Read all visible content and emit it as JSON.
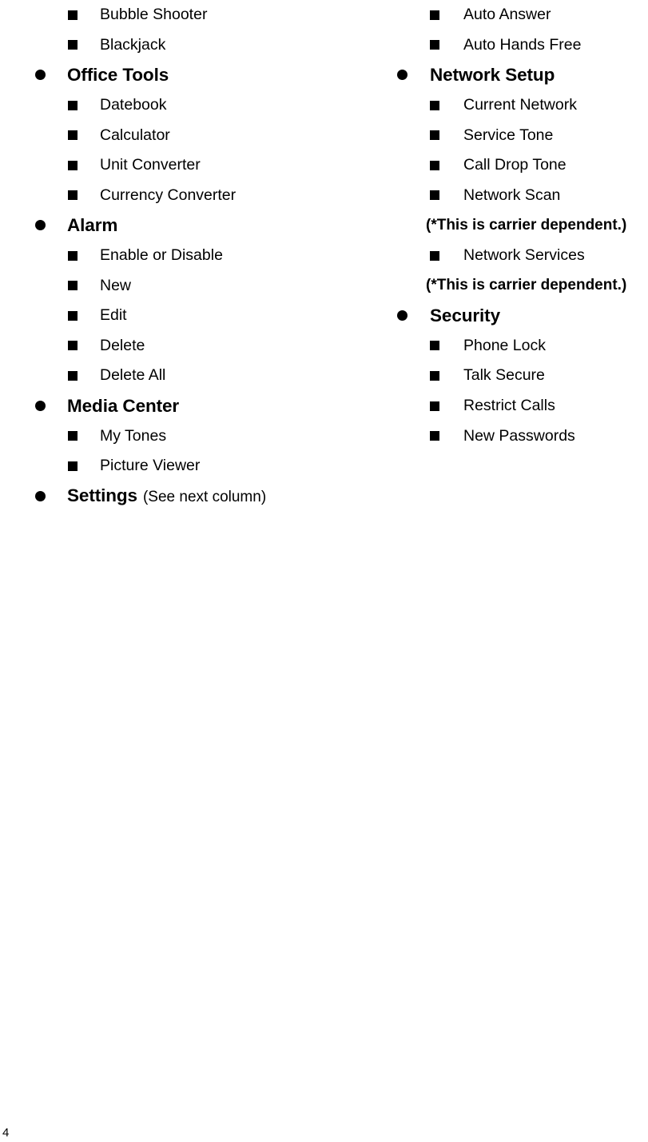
{
  "document": {
    "page_number": "4",
    "note_text": "(*This is carrier dependent.)"
  },
  "left_column": {
    "rows": [
      {
        "level": 2,
        "label": "Bubble Shooter"
      },
      {
        "level": 2,
        "label": "Blackjack"
      },
      {
        "level": 1,
        "label": "Office Tools"
      },
      {
        "level": 2,
        "label": "Datebook"
      },
      {
        "level": 2,
        "label": "Calculator"
      },
      {
        "level": 2,
        "label": "Unit Converter"
      },
      {
        "level": 2,
        "label": "Currency Converter"
      },
      {
        "level": 1,
        "label": "Alarm"
      },
      {
        "level": 2,
        "label": "Enable or Disable"
      },
      {
        "level": 2,
        "label": "New"
      },
      {
        "level": 2,
        "label": "Edit"
      },
      {
        "level": 2,
        "label": "Delete"
      },
      {
        "level": 2,
        "label": "Delete All"
      },
      {
        "level": 1,
        "label": "Media Center"
      },
      {
        "level": 2,
        "label": "My Tones"
      },
      {
        "level": 2,
        "label": "Picture Viewer"
      },
      {
        "level": 1,
        "label": "Settings",
        "sublabel": "(See next column)"
      }
    ]
  },
  "right_column": {
    "rows": [
      {
        "level": 2,
        "label": "Auto Answer"
      },
      {
        "level": 2,
        "label": "Auto Hands Free"
      },
      {
        "level": 1,
        "label": "Network Setup"
      },
      {
        "level": 2,
        "label": "Current Network"
      },
      {
        "level": 2,
        "label": "Service Tone"
      },
      {
        "level": 2,
        "label": "Call Drop Tone"
      },
      {
        "level": 2,
        "label": "Network Scan"
      },
      {
        "level": 0,
        "label": "(*This is carrier dependent.)"
      },
      {
        "level": 2,
        "label": "Network Services"
      },
      {
        "level": 0,
        "label": "(*This is carrier dependent.)"
      },
      {
        "level": 1,
        "label": "Security"
      },
      {
        "level": 2,
        "label": "Phone Lock"
      },
      {
        "level": 2,
        "label": "Talk Secure"
      },
      {
        "level": 2,
        "label": "Restrict Calls"
      },
      {
        "level": 2,
        "label": "New Passwords"
      }
    ]
  }
}
